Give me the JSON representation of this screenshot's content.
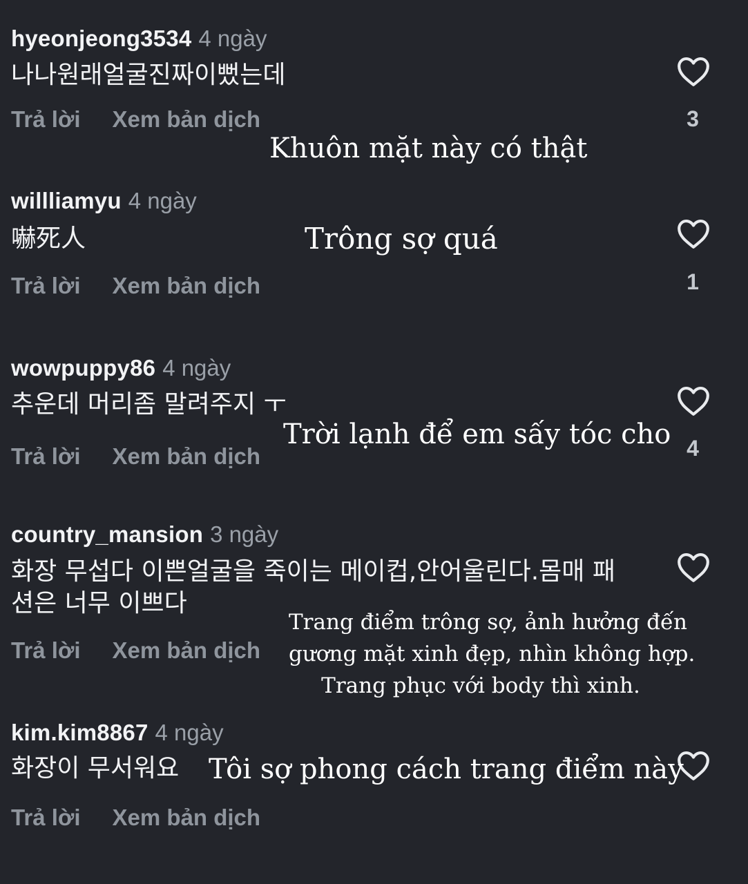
{
  "labels": {
    "reply": "Trả lời",
    "translate": "Xem bản dịch"
  },
  "comments": [
    {
      "username": "hyeonjeong3534",
      "time": "4 ngày",
      "text": "나나원래얼굴진짜이뻤는데",
      "likes": "3",
      "translation": "Khuôn mặt này có thật"
    },
    {
      "username": "willliamyu",
      "time": "4 ngày",
      "text": "嚇死人",
      "likes": "1",
      "translation": "Trông sợ quá"
    },
    {
      "username": "wowpuppy86",
      "time": "4 ngày",
      "text": "추운데 머리좀 말려주지 ㅜ",
      "likes": "4",
      "translation": "Trời lạnh để em sấy tóc cho"
    },
    {
      "username": "country_mansion",
      "time": "3 ngày",
      "text_line1": "화장 무섭다 이쁜얼굴을 죽이는 메이컵,안어울린다.몸매 패",
      "text_line2": "션은 너무 이쁘다",
      "likes": "",
      "translation_lines": [
        "Trang điểm trông sợ, ảnh hưởng đến",
        "gương mặt xinh đẹp, nhìn không hợp.",
        "Trang phục với body thì xinh."
      ]
    },
    {
      "username": "kim.kim8867",
      "time": "4 ngày",
      "text": "화장이 무서워요",
      "likes": "",
      "translation": "Tôi sợ phong cách trang điểm này"
    }
  ],
  "colors": {
    "background": "#23252b",
    "username": "#f2f3f5",
    "meta": "#8f959d",
    "heart_stroke": "#e9ebee"
  },
  "icons": {
    "like": "heart-outline-icon"
  }
}
